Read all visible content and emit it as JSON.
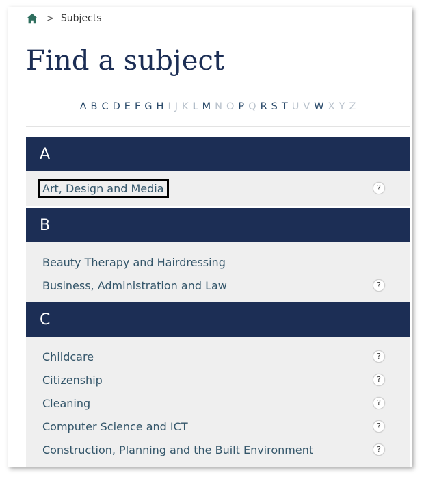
{
  "breadcrumb": {
    "separator": ">",
    "current": "Subjects"
  },
  "page": {
    "title": "Find a subject"
  },
  "alphabet": [
    {
      "letter": "A",
      "active": true
    },
    {
      "letter": "B",
      "active": true
    },
    {
      "letter": "C",
      "active": true
    },
    {
      "letter": "D",
      "active": true
    },
    {
      "letter": "E",
      "active": true
    },
    {
      "letter": "F",
      "active": true
    },
    {
      "letter": "G",
      "active": true
    },
    {
      "letter": "H",
      "active": true
    },
    {
      "letter": "I",
      "active": false
    },
    {
      "letter": "J",
      "active": false
    },
    {
      "letter": "K",
      "active": false
    },
    {
      "letter": "L",
      "active": true
    },
    {
      "letter": "M",
      "active": true
    },
    {
      "letter": "N",
      "active": false
    },
    {
      "letter": "O",
      "active": false
    },
    {
      "letter": "P",
      "active": true
    },
    {
      "letter": "Q",
      "active": false
    },
    {
      "letter": "R",
      "active": true
    },
    {
      "letter": "S",
      "active": true
    },
    {
      "letter": "T",
      "active": true
    },
    {
      "letter": "U",
      "active": false
    },
    {
      "letter": "V",
      "active": false
    },
    {
      "letter": "W",
      "active": true
    },
    {
      "letter": "X",
      "active": false
    },
    {
      "letter": "Y",
      "active": false
    },
    {
      "letter": "Z",
      "active": false
    }
  ],
  "sections": {
    "a": {
      "heading": "A",
      "subjects": [
        {
          "name": "Art, Design and Media",
          "help": "?"
        }
      ]
    },
    "b": {
      "heading": "B",
      "subjects": [
        {
          "name": "Beauty Therapy and Hairdressing"
        },
        {
          "name": "Business, Administration and Law",
          "help": "?"
        }
      ]
    },
    "c": {
      "heading": "C",
      "subjects": [
        {
          "name": "Childcare",
          "help": "?"
        },
        {
          "name": "Citizenship",
          "help": "?"
        },
        {
          "name": "Cleaning",
          "help": "?"
        },
        {
          "name": "Computer Science and ICT",
          "help": "?"
        },
        {
          "name": "Construction, Planning and the Built Environment",
          "help": "?"
        }
      ]
    }
  },
  "colors": {
    "header_bg": "#1c2e55",
    "row_bg": "#efefef",
    "link": "#34566a",
    "letter_active": "#2a4a6a",
    "letter_inactive": "#b9c2cc"
  }
}
